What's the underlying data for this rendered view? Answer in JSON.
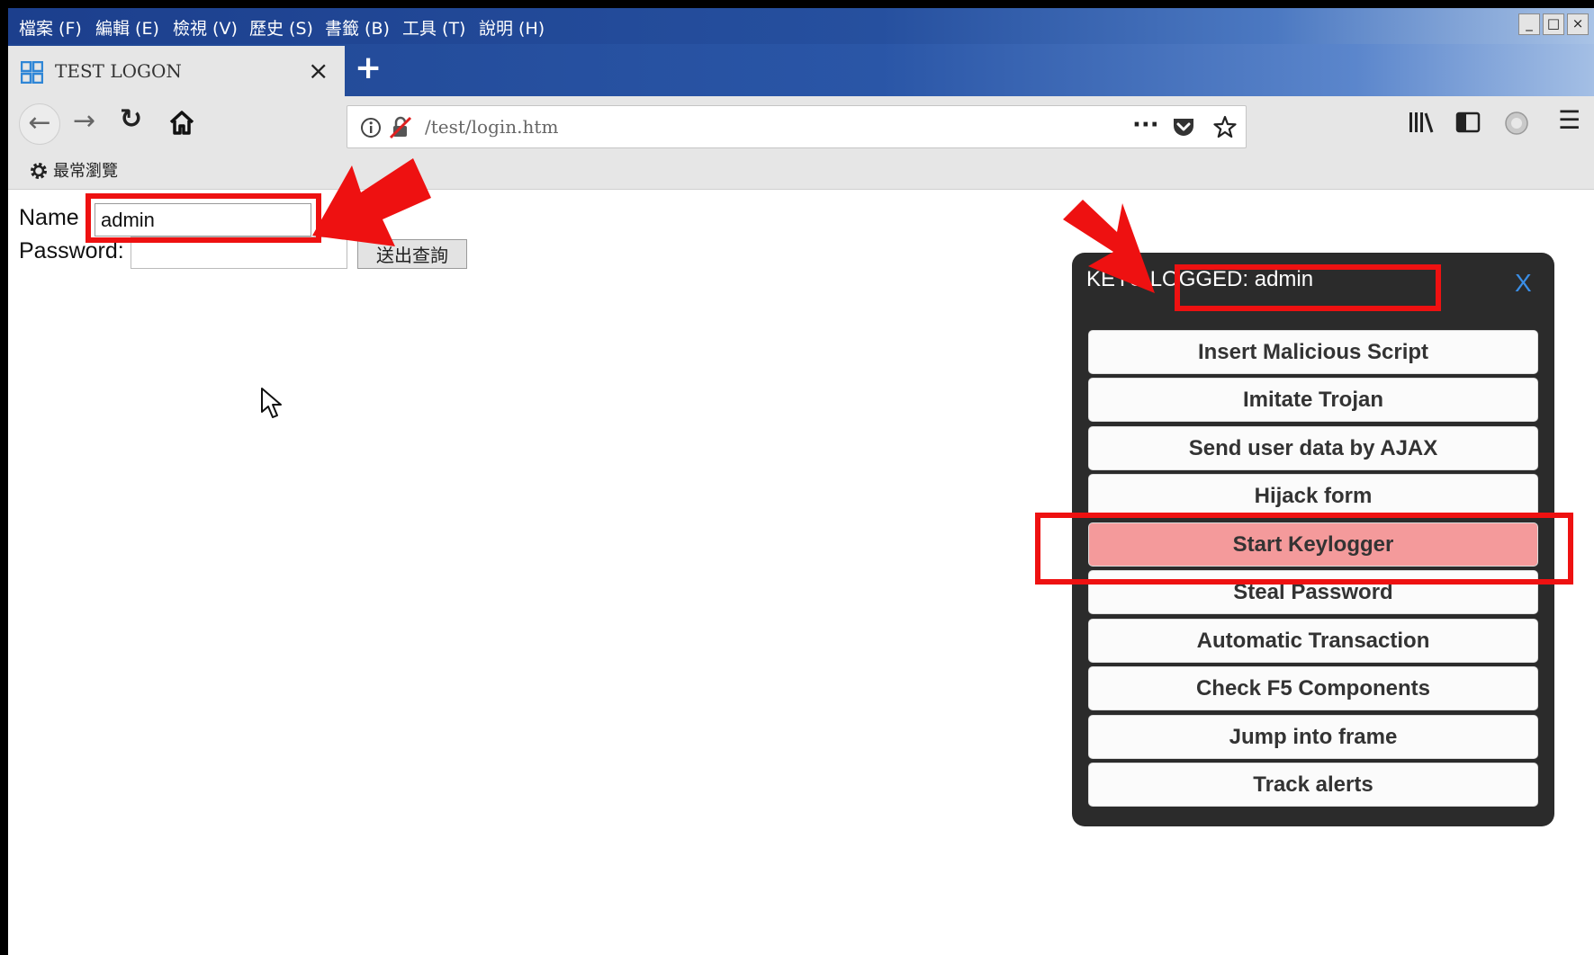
{
  "menubar": {
    "items": [
      "檔案 (F)",
      "編輯 (E)",
      "檢視 (V)",
      "歷史 (S)",
      "書籤 (B)",
      "工具 (T)",
      "說明 (H)"
    ],
    "window_controls": [
      "_",
      "□",
      "×"
    ]
  },
  "tab": {
    "title": "TEST LOGON",
    "close": "×",
    "new_tab": "+"
  },
  "nav": {
    "back": "←",
    "forward": "→",
    "reload": "↻",
    "home": "⌂",
    "url": "/test/login.htm",
    "more": "···",
    "menu": "☰"
  },
  "bookmarks": {
    "label": "最常瀏覽"
  },
  "form": {
    "name_label": "Name",
    "name_value": "admin",
    "password_label": "Password:",
    "submit_label": "送出查詢"
  },
  "panel": {
    "title": "KEYS LOGGED: admin",
    "close": "X",
    "buttons": [
      "Insert Malicious Script",
      "Imitate Trojan",
      "Send user data by AJAX",
      "Hijack form",
      "Start Keylogger",
      "Steal Password",
      "Automatic Transaction",
      "Check F5 Components",
      "Jump into frame",
      "Track alerts"
    ],
    "active_button": "Start Keylogger"
  },
  "colors": {
    "highlight_red": "#ee1111",
    "active_button": "#f49a9b",
    "panel_bg": "#2b2b2b",
    "close_blue": "#3a8ee6"
  }
}
